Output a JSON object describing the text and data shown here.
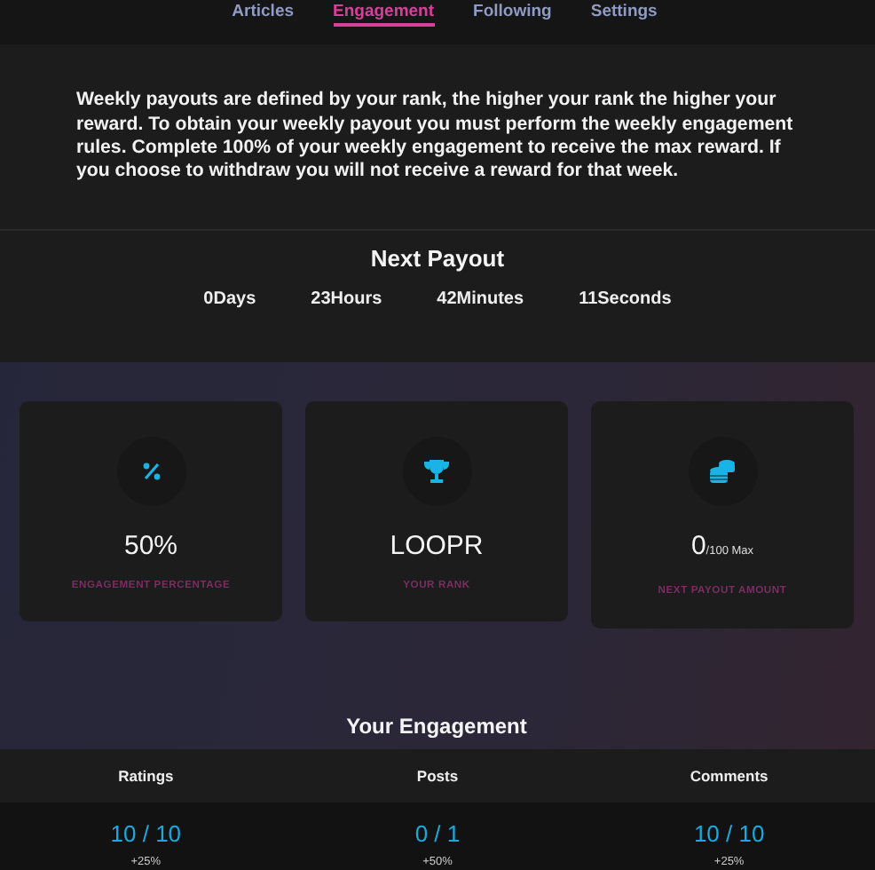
{
  "tabs": [
    {
      "label": "Articles",
      "selected": false
    },
    {
      "label": "Engagement",
      "selected": true
    },
    {
      "label": "Following",
      "selected": false
    },
    {
      "label": "Settings",
      "selected": false
    }
  ],
  "intro": "Weekly payouts are defined by your rank, the higher your rank the higher your reward. To obtain your weekly payout you must perform the weekly engagement rules. Complete 100% of your weekly engagement to receive the max reward. If you choose to withdraw you will not receive a reward for that week.",
  "next_payout": {
    "title": "Next Payout",
    "countdown": [
      "0Days",
      "23Hours",
      "42Minutes",
      "11Seconds"
    ]
  },
  "stats": [
    {
      "kind": "percent",
      "value": "50%",
      "label": "ENGAGEMENT PERCENTAGE"
    },
    {
      "kind": "trophy",
      "value": "LOOPR",
      "label": "YOUR RANK"
    },
    {
      "kind": "coins",
      "value": "0",
      "suffix": "/100 Max",
      "label": "NEXT PAYOUT AMOUNT"
    }
  ],
  "engagement": {
    "title": "Your Engagement",
    "columns": [
      {
        "name": "Ratings",
        "progress": "10 / 10",
        "bonus": "+25%"
      },
      {
        "name": "Posts",
        "progress": "0 / 1",
        "bonus": "+50%"
      },
      {
        "name": "Comments",
        "progress": "10 / 10",
        "bonus": "+25%"
      }
    ]
  }
}
